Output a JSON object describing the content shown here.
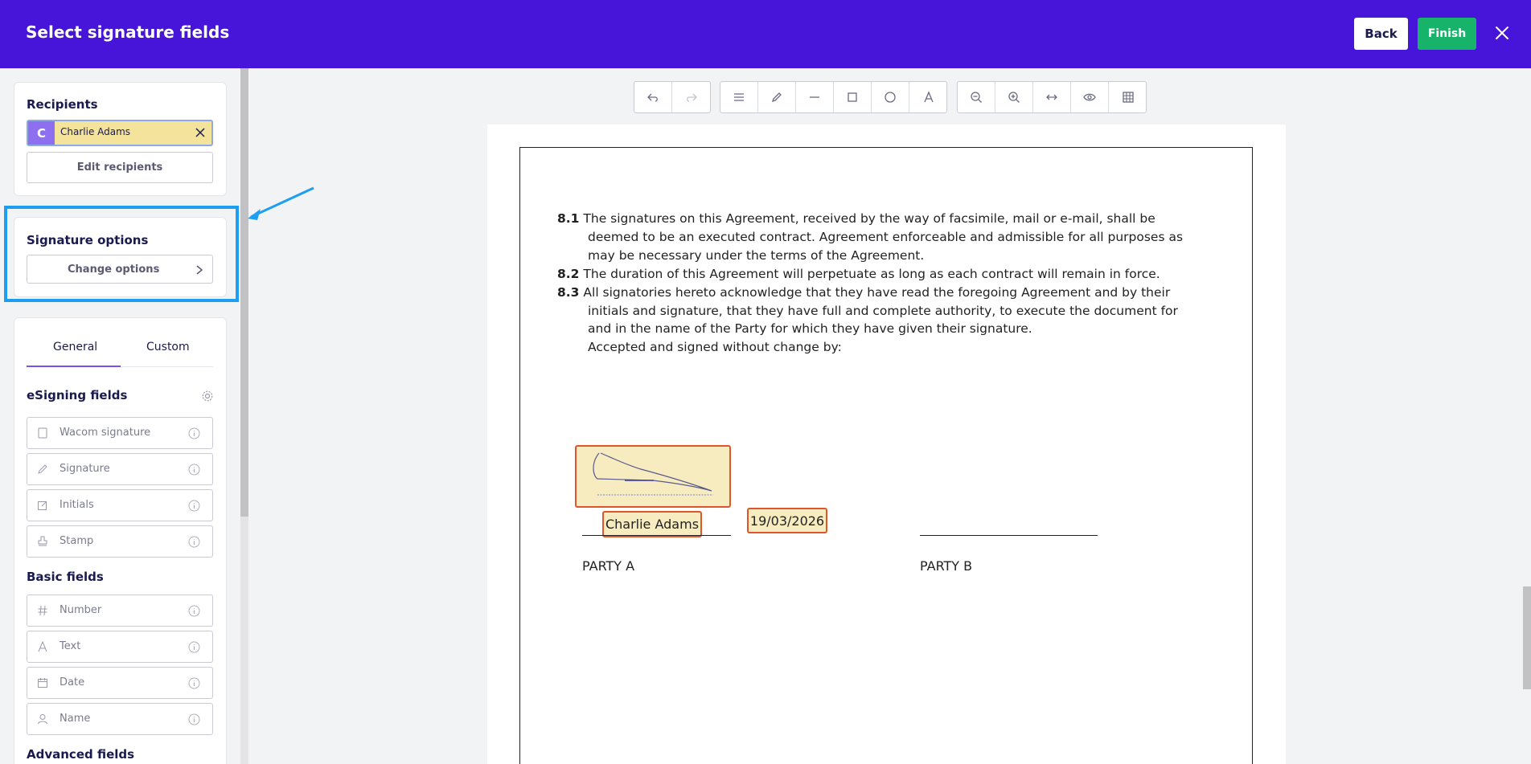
{
  "header": {
    "title": "Select signature fields",
    "back_label": "Back",
    "finish_label": "Finish"
  },
  "recipients": {
    "title": "Recipients",
    "selected": {
      "initial": "C",
      "name": "Charlie Adams"
    },
    "edit_label": "Edit recipients"
  },
  "signature_options": {
    "title": "Signature options",
    "change_label": "Change options"
  },
  "tabs": {
    "general": "General",
    "custom": "Custom"
  },
  "esigning": {
    "title": "eSigning fields",
    "items": [
      {
        "label": "Wacom signature",
        "icon": "tablet-icon"
      },
      {
        "label": "Signature",
        "icon": "pen-icon"
      },
      {
        "label": "Initials",
        "icon": "edit-icon"
      },
      {
        "label": "Stamp",
        "icon": "stamp-icon"
      }
    ]
  },
  "basic": {
    "title": "Basic fields",
    "items": [
      {
        "label": "Number",
        "icon": "hash-icon"
      },
      {
        "label": "Text",
        "icon": "text-icon"
      },
      {
        "label": "Date",
        "icon": "calendar-icon"
      },
      {
        "label": "Name",
        "icon": "user-icon"
      }
    ]
  },
  "advanced": {
    "title": "Advanced fields"
  },
  "document": {
    "clauses": [
      {
        "num": "8.1",
        "lines": [
          "The signatures on this Agreement, received by the way of facsimile, mail or e-mail, shall be",
          "deemed to be an executed contract. Agreement enforceable and admissible for all purposes as",
          "may be necessary under the terms of the Agreement."
        ]
      },
      {
        "num": "8.2",
        "lines": [
          "The duration of this Agreement will perpetuate as long as each contract will remain in force."
        ]
      },
      {
        "num": "8.3",
        "lines": [
          "All signatories hereto acknowledge that they have read the foregoing Agreement and by their",
          "initials and signature, that they have full and complete authority, to execute the document for",
          "and in the name of the Party for which they have given their signature.",
          "Accepted and signed without change by:"
        ]
      }
    ],
    "name_field": "Charlie Adams",
    "date_field": "19/03/2026",
    "party_a": "PARTY A",
    "party_b": "PARTY B"
  },
  "colors": {
    "header": "#4714d9",
    "finish": "#18b36b",
    "field_border": "#e0562a",
    "field_fill": "#f7ecc0",
    "highlight": "#1e9ef0"
  }
}
